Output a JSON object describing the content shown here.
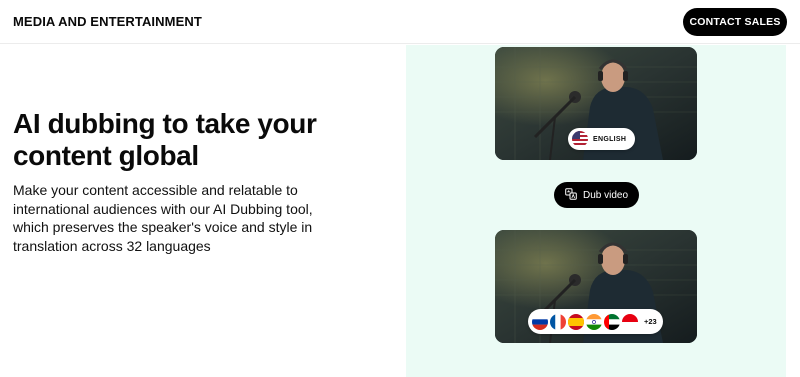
{
  "header": {
    "brand": "MEDIA AND ENTERTAINMENT",
    "cta_label": "CONTACT SALES"
  },
  "hero": {
    "title": "AI dubbing to take your content global",
    "description": "Make your content accessible and relatable to international audiences with our AI Dubbing tool, which preserves the speaker's voice and style in translation across 32 languages"
  },
  "demo": {
    "source_language": "ENGLISH",
    "source_flag_icon": "us-flag-icon",
    "dub_button_label": "Dub video",
    "dub_button_icon": "translate-icon",
    "target_flags": [
      "russia-flag-icon",
      "france-flag-icon",
      "spain-flag-icon",
      "india-flag-icon",
      "uae-flag-icon",
      "indonesia-flag-icon"
    ],
    "more_languages": "+23"
  },
  "colors": {
    "panel_bg": "#ebfbf5",
    "button_bg": "#000000"
  }
}
